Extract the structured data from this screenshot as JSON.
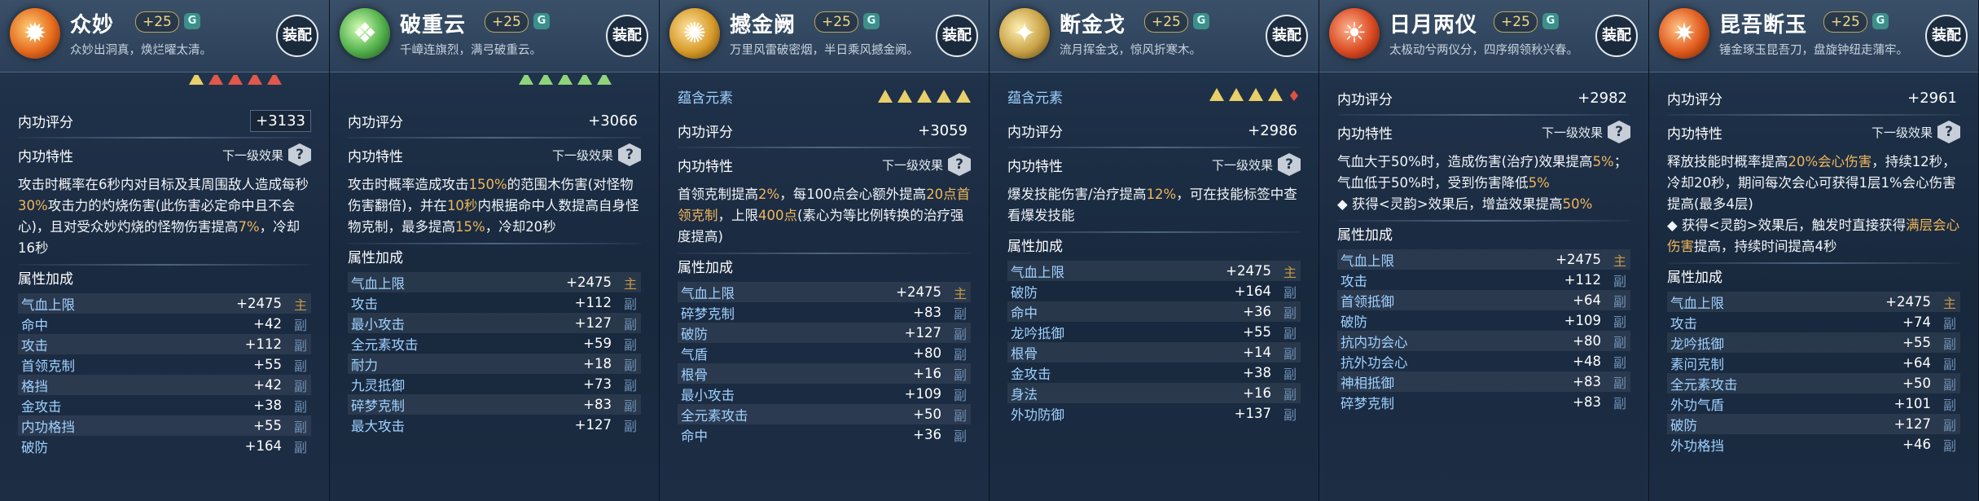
{
  "equip_label": "装配",
  "inner_score_label": "内功评分",
  "inner_trait_label": "内功特性",
  "next_level_label": "下一级效果",
  "attr_bonus_label": "属性加成",
  "element_label": "蕴含元素",
  "panels": [
    {
      "name": "众妙",
      "level": "+25",
      "grade": "G",
      "subtitle": "众妙出洞真，焕烂曜太清。",
      "icon": "fire-orb-icon",
      "score": "+3133",
      "desc_parts": [
        {
          "t": "攻击时概率在6秒内对目标及其周围敌人造成每秒"
        },
        {
          "t": "30%",
          "hl": true
        },
        {
          "t": "攻击力的灼烧伤害(此伤害必定命中且不会心)，且对受众妙灼烧的怪物伤害提高"
        },
        {
          "t": "7%",
          "hl": true
        },
        {
          "t": "，冷却16秒"
        }
      ],
      "attrs": [
        {
          "name": "气血上限",
          "value": "+2475",
          "tag": "主"
        },
        {
          "name": "命中",
          "value": "+42",
          "tag": "副"
        },
        {
          "name": "攻击",
          "value": "+112",
          "tag": "副"
        },
        {
          "name": "首领克制",
          "value": "+55",
          "tag": "副"
        },
        {
          "name": "格挡",
          "value": "+42",
          "tag": "副"
        },
        {
          "name": "金攻击",
          "value": "+38",
          "tag": "副"
        },
        {
          "name": "内功格挡",
          "value": "+55",
          "tag": "副"
        },
        {
          "name": "破防",
          "value": "+164",
          "tag": "副"
        }
      ]
    },
    {
      "name": "破重云",
      "level": "+25",
      "grade": "G",
      "subtitle": "千嶂连旗烈，满弓破重云。",
      "icon": "green-crystal-icon",
      "score": "+3066",
      "desc_parts": [
        {
          "t": "攻击时概率造成攻击"
        },
        {
          "t": "150%",
          "hl": true
        },
        {
          "t": "的范围木伤害(对怪物伤害翻倍)，并在"
        },
        {
          "t": "10秒",
          "hl": true
        },
        {
          "t": "内根据命中人数提高自身怪物克制，最多提高"
        },
        {
          "t": "15%",
          "hl": true
        },
        {
          "t": "，冷却20秒"
        }
      ],
      "attrs": [
        {
          "name": "气血上限",
          "value": "+2475",
          "tag": "主"
        },
        {
          "name": "攻击",
          "value": "+112",
          "tag": "副"
        },
        {
          "name": "最小攻击",
          "value": "+127",
          "tag": "副"
        },
        {
          "name": "全元素攻击",
          "value": "+59",
          "tag": "副"
        },
        {
          "name": "耐力",
          "value": "+18",
          "tag": "副"
        },
        {
          "name": "九灵抵御",
          "value": "+73",
          "tag": "副"
        },
        {
          "name": "碎梦克制",
          "value": "+83",
          "tag": "副"
        },
        {
          "name": "最大攻击",
          "value": "+127",
          "tag": "副"
        }
      ]
    },
    {
      "name": "撼金阙",
      "level": "+25",
      "grade": "G",
      "subtitle": "万里风雷破密烟，半日乘风撼金阙。",
      "icon": "gold-storm-icon",
      "score": "+3059",
      "desc_parts": [
        {
          "t": "首领克制提高"
        },
        {
          "t": "2%",
          "hl": true
        },
        {
          "t": "，每100点会心额外提高"
        },
        {
          "t": "20点首领克制",
          "hl": true
        },
        {
          "t": "，上限"
        },
        {
          "t": "400点",
          "hl": true
        },
        {
          "t": "(素心为等比例转换的治疗强度提高)"
        }
      ],
      "attrs": [
        {
          "name": "气血上限",
          "value": "+2475",
          "tag": "主"
        },
        {
          "name": "碎梦克制",
          "value": "+83",
          "tag": "副"
        },
        {
          "name": "破防",
          "value": "+127",
          "tag": "副"
        },
        {
          "name": "气盾",
          "value": "+80",
          "tag": "副"
        },
        {
          "name": "根骨",
          "value": "+16",
          "tag": "副"
        },
        {
          "name": "最小攻击",
          "value": "+109",
          "tag": "副"
        },
        {
          "name": "全元素攻击",
          "value": "+50",
          "tag": "副"
        },
        {
          "name": "命中",
          "value": "+36",
          "tag": "副"
        }
      ]
    },
    {
      "name": "断金戈",
      "level": "+25",
      "grade": "G",
      "subtitle": "流月挥金戈，惊风折寒木。",
      "icon": "golden-blade-icon",
      "score": "+2986",
      "desc_parts": [
        {
          "t": "爆发技能伤害/治疗提高"
        },
        {
          "t": "12%",
          "hl": true
        },
        {
          "t": "，可在技能标签中查看爆发技能"
        }
      ],
      "attrs": [
        {
          "name": "气血上限",
          "value": "+2475",
          "tag": "主"
        },
        {
          "name": "破防",
          "value": "+164",
          "tag": "副"
        },
        {
          "name": "命中",
          "value": "+36",
          "tag": "副"
        },
        {
          "name": "龙吟抵御",
          "value": "+55",
          "tag": "副"
        },
        {
          "name": "根骨",
          "value": "+14",
          "tag": "副"
        },
        {
          "name": "金攻击",
          "value": "+38",
          "tag": "副"
        },
        {
          "name": "身法",
          "value": "+16",
          "tag": "副"
        },
        {
          "name": "外功防御",
          "value": "+137",
          "tag": "副"
        }
      ]
    },
    {
      "name": "日月两仪",
      "level": "+25",
      "grade": "G",
      "subtitle": "太极动兮两仪分，四序纲领秋兴春。",
      "icon": "sun-moon-icon",
      "score": "+2982",
      "desc_parts": [
        {
          "t": "气血大于50%时，造成伤害(治疗)效果提高"
        },
        {
          "t": "5%",
          "hl": true
        },
        {
          "t": "；气血低于50%时，受到伤害降低"
        },
        {
          "t": "5%",
          "hl": true
        },
        {
          "t": "\n◆ 获得<灵韵>效果后，增益效果提高"
        },
        {
          "t": "50%",
          "hl": true
        }
      ],
      "attrs": [
        {
          "name": "气血上限",
          "value": "+2475",
          "tag": "主"
        },
        {
          "name": "攻击",
          "value": "+112",
          "tag": "副"
        },
        {
          "name": "首领抵御",
          "value": "+64",
          "tag": "副"
        },
        {
          "name": "破防",
          "value": "+109",
          "tag": "副"
        },
        {
          "name": "抗内功会心",
          "value": "+80",
          "tag": "副"
        },
        {
          "name": "抗外功会心",
          "value": "+48",
          "tag": "副"
        },
        {
          "name": "神相抵御",
          "value": "+83",
          "tag": "副"
        },
        {
          "name": "碎梦克制",
          "value": "+83",
          "tag": "副"
        }
      ]
    },
    {
      "name": "昆吾断玉",
      "level": "+25",
      "grade": "G",
      "subtitle": "锤金琢玉昆吾刀，盘旋钟纽走蒲牢。",
      "icon": "flame-sword-icon",
      "score": "+2961",
      "desc_parts": [
        {
          "t": "释放技能时概率提高"
        },
        {
          "t": "20%会心伤害",
          "hl": true
        },
        {
          "t": "，持续12秒，冷却20秒，期间每次会心可获得1层1%会心伤害提高(最多4层)\n◆ 获得<灵韵>效果后，触发时直接获得"
        },
        {
          "t": "满层会心伤害",
          "hl": true
        },
        {
          "t": "提高，持续时间提高4秒"
        }
      ],
      "attrs": [
        {
          "name": "气血上限",
          "value": "+2475",
          "tag": "主"
        },
        {
          "name": "攻击",
          "value": "+74",
          "tag": "副"
        },
        {
          "name": "龙吟抵御",
          "value": "+55",
          "tag": "副"
        },
        {
          "name": "素问克制",
          "value": "+64",
          "tag": "副"
        },
        {
          "name": "全元素攻击",
          "value": "+50",
          "tag": "副"
        },
        {
          "name": "外功气盾",
          "value": "+101",
          "tag": "副"
        },
        {
          "name": "破防",
          "value": "+127",
          "tag": "副"
        },
        {
          "name": "外功格挡",
          "value": "+46",
          "tag": "副"
        }
      ]
    }
  ]
}
